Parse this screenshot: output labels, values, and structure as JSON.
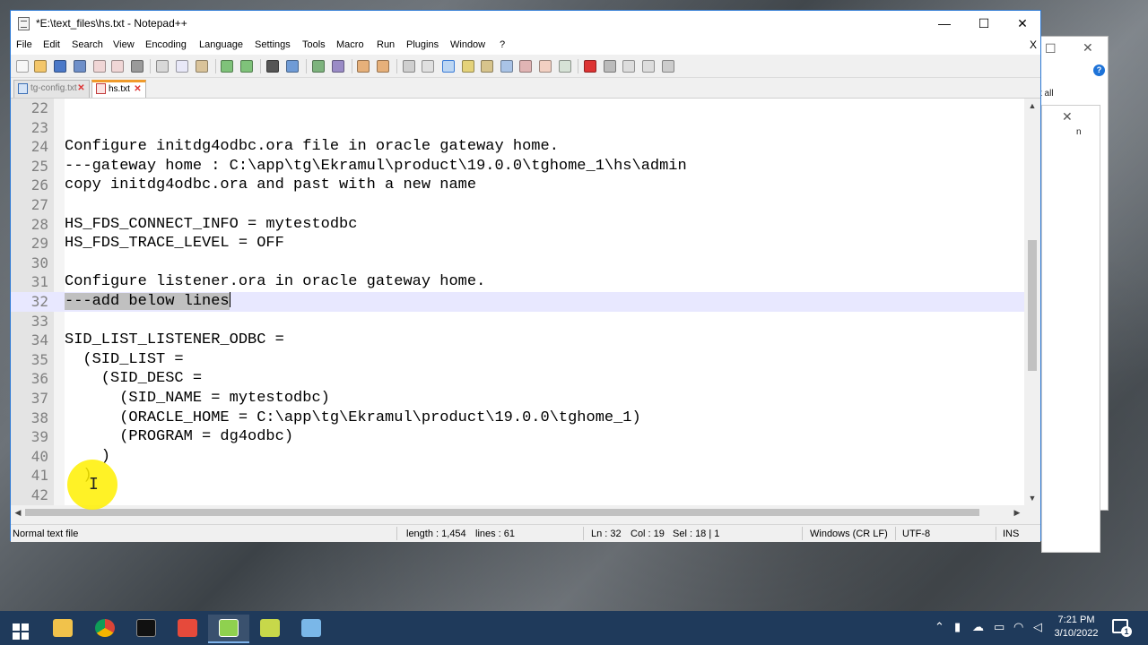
{
  "window": {
    "title": "*E:\\text_files\\hs.txt - Notepad++",
    "minimize": "—",
    "maximize": "☐",
    "close": "✕"
  },
  "menu": [
    "File",
    "Edit",
    "Search",
    "View",
    "Encoding",
    "Language",
    "Settings",
    "Tools",
    "Macro",
    "Run",
    "Plugins",
    "Window",
    "?"
  ],
  "menu_close": "X",
  "tabs": [
    {
      "label": "tg-config.txt",
      "active": false
    },
    {
      "label": "hs.txt",
      "active": true
    }
  ],
  "editor": {
    "lines": [
      {
        "n": "22",
        "text": ""
      },
      {
        "n": "23",
        "text": ""
      },
      {
        "n": "24",
        "text": "Configure initdg4odbc.ora file in oracle gateway home."
      },
      {
        "n": "25",
        "text": "---gateway home : C:\\app\\tg\\Ekramul\\product\\19.0.0\\tghome_1\\hs\\admin"
      },
      {
        "n": "26",
        "text": "copy initdg4odbc.ora and past with a new name"
      },
      {
        "n": "27",
        "text": ""
      },
      {
        "n": "28",
        "text": "HS_FDS_CONNECT_INFO = mytestodbc"
      },
      {
        "n": "29",
        "text": "HS_FDS_TRACE_LEVEL = OFF"
      },
      {
        "n": "30",
        "text": ""
      },
      {
        "n": "31",
        "text": "Configure listener.ora in oracle gateway home."
      },
      {
        "n": "32",
        "text": "---add below lines"
      },
      {
        "n": "33",
        "text": ""
      },
      {
        "n": "34",
        "text": "SID_LIST_LISTENER_ODBC ="
      },
      {
        "n": "35",
        "text": "  (SID_LIST ="
      },
      {
        "n": "36",
        "text": "    (SID_DESC ="
      },
      {
        "n": "37",
        "text": "      (SID_NAME = mytestodbc)"
      },
      {
        "n": "38",
        "text": "      (ORACLE_HOME = C:\\app\\tg\\Ekramul\\product\\19.0.0\\tghome_1)"
      },
      {
        "n": "39",
        "text": "      (PROGRAM = dg4odbc)"
      },
      {
        "n": "40",
        "text": "    )"
      },
      {
        "n": "41",
        "text": "  )"
      },
      {
        "n": "42",
        "text": ""
      }
    ],
    "current_line": "32"
  },
  "status": {
    "file_type": "Normal text file",
    "length": "length : 1,454",
    "lines": "lines : 61",
    "ln": "Ln : 32",
    "col": "Col : 19",
    "sel": "Sel : 18 | 1",
    "eol": "Windows (CR LF)",
    "encoding": "UTF-8",
    "mode": "INS"
  },
  "background_window": {
    "partial_text_1": "t all",
    "partial_text_2": "n",
    "help": "?"
  },
  "taskbar": {
    "time": "7:21 PM",
    "date": "3/10/2022",
    "notification_count": "1"
  }
}
